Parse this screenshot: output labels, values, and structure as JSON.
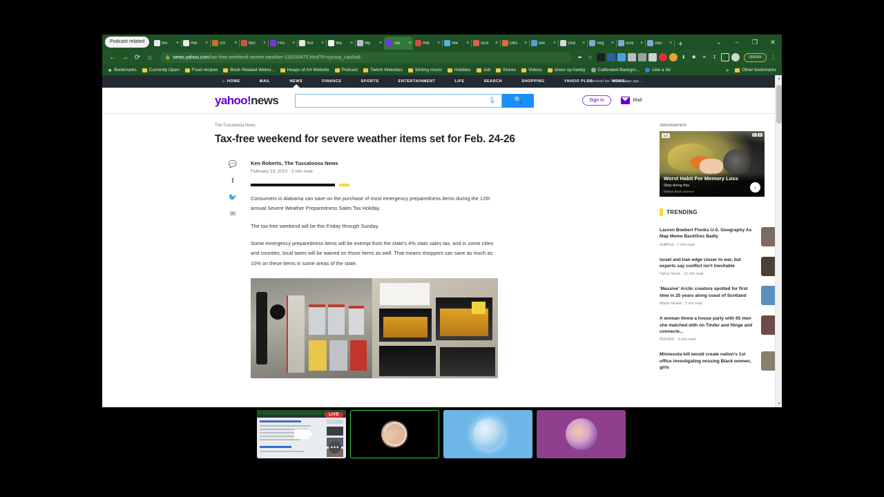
{
  "browser": {
    "tab_group_label": "Podcast related",
    "tabs": [
      {
        "title": "NA",
        "color": "#e8eaed"
      },
      {
        "title": "Hid",
        "color": "#e8eaed"
      },
      {
        "title": "US ",
        "color": "#c9731f"
      },
      {
        "title": "McI",
        "color": "#d4543a"
      },
      {
        "title": "Firs",
        "color": "#7b2ff2"
      },
      {
        "title": "Nor",
        "color": "#e5e5e5"
      },
      {
        "title": "Wa",
        "color": "#f1f1f1"
      },
      {
        "title": "My",
        "color": "#b9bec4"
      },
      {
        "title": "Tax",
        "color": "#7b2ff2",
        "active": true
      },
      {
        "title": "Hot",
        "color": "#e24a3c"
      },
      {
        "title": "We",
        "color": "#5ab0e0"
      },
      {
        "title": "scre",
        "color": "#e2604a"
      },
      {
        "title": "Ob1",
        "color": "#e06a3c"
      },
      {
        "title": "ww",
        "color": "#5f9ad4"
      },
      {
        "title": "Ove",
        "color": "#d9d9d9"
      },
      {
        "title": "Veg",
        "color": "#7fa9d0"
      },
      {
        "title": "scre",
        "color": "#7fa9d0"
      },
      {
        "title": "Adv",
        "color": "#7fa9d0"
      }
    ],
    "new_tab_label": "+",
    "window_controls": [
      "⌄",
      "–",
      "❐",
      "✕"
    ],
    "nav": {
      "back": "←",
      "forward": "→",
      "reload": "⟳",
      "home": "⌂"
    },
    "url_lock": "🔒",
    "url_domain": "news.yahoo.com",
    "url_path": "/tax-free-weekend-severe-weather-110259475.html?fr=sycsrp_catchall",
    "toolbar_icons": [
      "share-icon",
      "bookmark-star-icon",
      "extension-screen-icon",
      "extension-blue-icon",
      "extension-cloud-icon",
      "extension-grey1-icon",
      "extension-grey2-icon",
      "extension-grey3-icon",
      "extension-red-icon",
      "extension-orange-icon",
      "extension-download-icon",
      "extension-puzzle-icon",
      "reading-list-icon",
      "downloads-icon",
      "sidepanel-icon",
      "profile-icon"
    ],
    "update_label": "Update",
    "menu_icon": "⋮",
    "bookmarks": [
      {
        "label": "Bookmarks",
        "icon": "star-icon"
      },
      {
        "label": "Currently Open",
        "icon": "folder-icon"
      },
      {
        "label": "Food recipes",
        "icon": "folder-icon"
      },
      {
        "label": "Book Related Websi...",
        "icon": "folder-icon"
      },
      {
        "label": "Heaps of Art Website",
        "icon": "folder-icon"
      },
      {
        "label": "Podcast",
        "icon": "folder-icon"
      },
      {
        "label": "Twitch Websites",
        "icon": "folder-icon"
      },
      {
        "label": "Writing music",
        "icon": "folder-icon"
      },
      {
        "label": "Hobbies",
        "icon": "folder-icon"
      },
      {
        "label": "Job",
        "icon": "folder-icon"
      },
      {
        "label": "Stores",
        "icon": "folder-icon"
      },
      {
        "label": "Videos",
        "icon": "folder-icon"
      },
      {
        "label": "cheer up harley",
        "icon": "folder-icon"
      },
      {
        "label": "Calibrated Backgro...",
        "icon": "globe-grey-icon"
      },
      {
        "label": "Like a Sir",
        "icon": "globe-blue-icon"
      }
    ],
    "bookmarks_overflow": "»",
    "other_bookmarks": "Other bookmarks"
  },
  "yahoo": {
    "nav_items": [
      "HOME",
      "MAIL",
      "NEWS",
      "FINANCE",
      "SPORTS",
      "ENTERTAINMENT",
      "LIFE",
      "SEARCH",
      "SHOPPING",
      "YAHOO PLUS",
      "MORE..."
    ],
    "nav_selected": "NEWS",
    "app_download": "Download the Yahoo News app  →",
    "logo_purple": "yahoo!",
    "logo_black": "news",
    "search_placeholder": "",
    "search_value": "",
    "mic_icon": "🎙",
    "search_button_icon": "🔍",
    "signin_label": "Sign in",
    "mail_label": "Mail"
  },
  "article": {
    "source": "The Tuscaloosa News",
    "headline": "Tax-free weekend for severe weather items set for Feb. 24-26",
    "author": "Ken Roberts, The Tuscaloosa News",
    "date": "February 23, 2023",
    "read_time": "2 min read",
    "meta_separator": "·",
    "share_icons": [
      "comment-icon",
      "facebook-icon",
      "twitter-icon",
      "email-icon"
    ],
    "share_glyphs": [
      "○",
      "f",
      "➤",
      "✉"
    ],
    "paragraphs": [
      "Consumers in Alabama can save on the purchase of most emergency preparedness items during the 12th annual Severe Weather Preparedness Sales Tax Holiday.",
      "The tax-free weekend will be this Friday through Sunday.",
      "Some emergency preparedness items will be exempt from the state's 4% state sales tax, and in some cities and counties, local taxes will be waived on those items as well. That means shoppers can save as much as 10% on these items in some areas of the state."
    ],
    "image_caption": "Hardware store shelf with flashlights and Duracell batteries"
  },
  "rail": {
    "ad_label": "Advertisement",
    "close_icon": "✕",
    "ad_badge": "AD",
    "ad_choices": [
      "▷",
      "✕"
    ],
    "ad_title": "Worst Habit For Memory Loss",
    "ad_sub": "Stop doing this.",
    "ad_brand": "Boston Brain Science",
    "ad_arrow": "›",
    "trending_label": "TRENDING",
    "trending": [
      {
        "title": "Lauren Boebert Flunks U.S. Geography As Map Meme Backfires Badly",
        "source": "HuffPost",
        "read": "2 min read",
        "thumb": "#7b6a60"
      },
      {
        "title": "Israel and Iran edge closer to war, but experts say conflict isn't inevitable",
        "source": "Yahoo News",
        "read": "12 min read",
        "thumb": "#4a4136"
      },
      {
        "title": "'Massive' Arctic creature spotted for first time in 25 years along coast of Scotland",
        "source": "Miami Herald",
        "read": "2 min read",
        "thumb": "#5b8fc0"
      },
      {
        "title": "A woman threw a house party with 65 men she matched with on Tinder and Hinge and connecte...",
        "source": "INSIDER",
        "read": "5 min read",
        "thumb": "#6e4a48"
      },
      {
        "title": "Minnesota bill would create nation's 1st office investigating missing Black women, girls",
        "source": "",
        "read": "",
        "thumb": "#8a7f6e"
      }
    ]
  },
  "dock": {
    "live_badge": "LIVE",
    "cells": [
      {
        "name": "screen-share-tile",
        "type": "screen"
      },
      {
        "name": "participant-tile-bear",
        "type": "active"
      },
      {
        "name": "participant-tile-moon",
        "type": "moon"
      },
      {
        "name": "participant-tile-avatar",
        "type": "purple"
      }
    ],
    "more_icon": "•••"
  },
  "colors": {
    "browser_chrome": "#1e5226",
    "yahoo_purple": "#6001d2",
    "yahoo_nav_dark": "#232a31",
    "accent_yellow": "#fdd835",
    "search_blue": "#188fff",
    "live_red": "#d32f2f",
    "active_tile_green": "#2fd34a"
  }
}
